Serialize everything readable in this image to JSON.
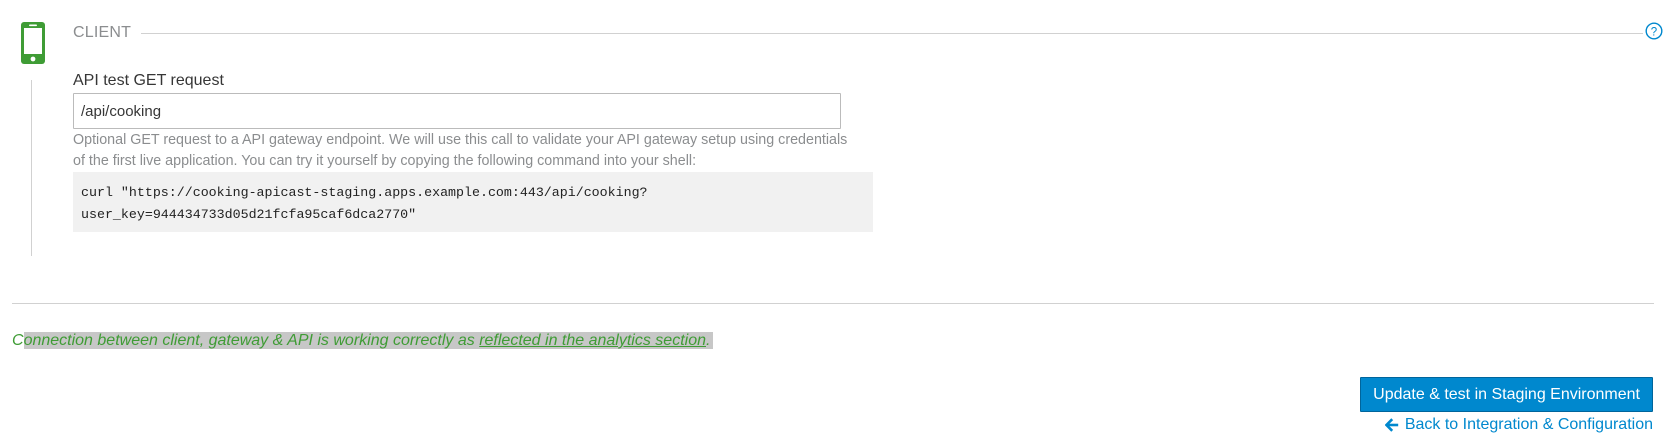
{
  "client": {
    "section_title": "CLIENT",
    "icon": "mobile-phone-icon",
    "help_icon": "question-circle-icon",
    "field_label": "API test GET request",
    "input_value": "/api/cooking",
    "help_text": "Optional GET request to a API gateway endpoint. We will use this call to validate your API gateway setup using credentials of the first live application. You can try it yourself by copying the following command into your shell:",
    "command_line1": "curl \"https://cooking-apicast-staging.apps.example.com:443/api/cooking?",
    "command_line2": "user_key=944434733d05d21fcfa95caf6dca2770\""
  },
  "status": {
    "first_char": "C",
    "text_before_link": "onnection between client, gateway & API is working correctly as ",
    "link_text": "reflected in the analytics section",
    "text_after_link": ".",
    "color": "#3f9c35"
  },
  "actions": {
    "primary_button_label": "Update & test in Staging Environment",
    "back_link_label": "Back to Integration & Configuration",
    "back_icon": "arrow-left-icon",
    "accent_color": "#0088ce"
  }
}
